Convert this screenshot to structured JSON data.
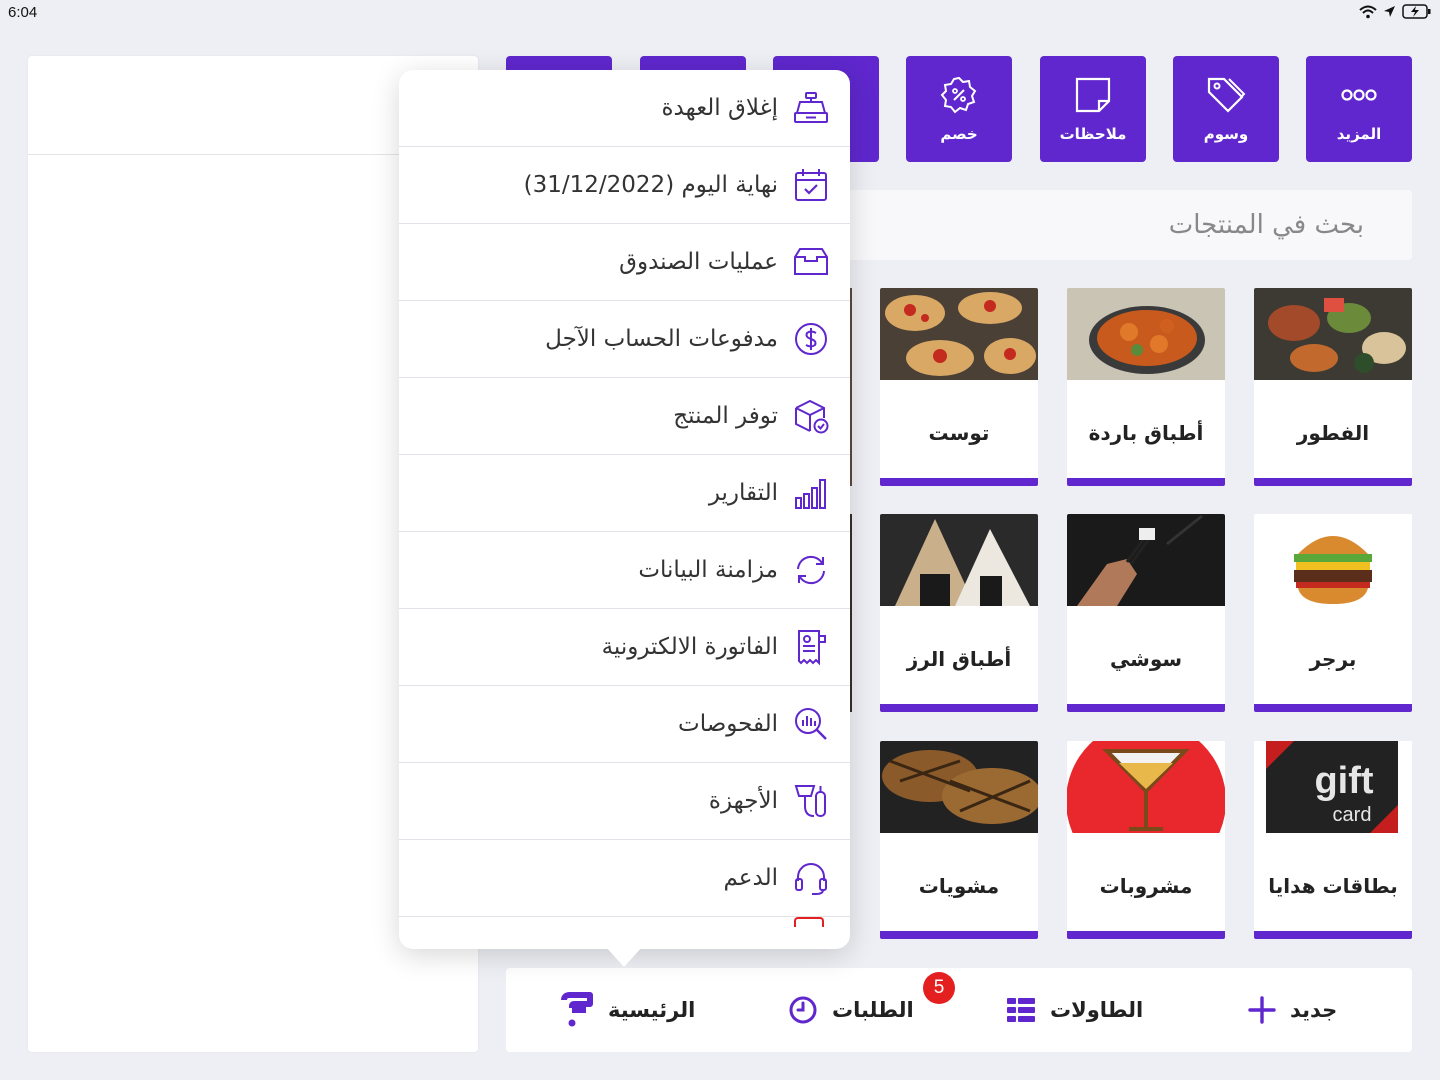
{
  "status": {
    "time": "6:04"
  },
  "top_buttons": [
    {
      "label": "المزيد",
      "icon": "more-dots-icon"
    },
    {
      "label": "وسوم",
      "icon": "tags-icon"
    },
    {
      "label": "ملاحظات",
      "icon": "notes-icon"
    },
    {
      "label": "خصم",
      "icon": "discount-icon"
    }
  ],
  "search": {
    "placeholder": "بحث في المنتجات"
  },
  "categories": [
    {
      "label": "الفطور",
      "image": "breakfast-image"
    },
    {
      "label": "أطباق باردة",
      "image": "cold-dishes-image"
    },
    {
      "label": "توست",
      "image": "toast-image"
    },
    {
      "label": "برجر",
      "image": "burger-image"
    },
    {
      "label": "سوشي",
      "image": "sushi-image"
    },
    {
      "label": "أطباق الرز",
      "image": "rice-dishes-image"
    },
    {
      "label": "بطاقات هدايا",
      "image": "gift-card-image",
      "image_text_1": "gift",
      "image_text_2": "card"
    },
    {
      "label": "مشروبات",
      "image": "drinks-image"
    },
    {
      "label": "مشويات",
      "image": "grills-image"
    }
  ],
  "menu": {
    "items": [
      {
        "label": "إغلاق العهدة",
        "icon": "cash-register-icon"
      },
      {
        "label": "نهاية اليوم (31/12/2022)",
        "icon": "calendar-check-icon"
      },
      {
        "label": "عمليات الصندوق",
        "icon": "cash-drawer-icon"
      },
      {
        "label": "مدفوعات الحساب الآجل",
        "icon": "dollar-circle-icon"
      },
      {
        "label": "توفر المنتج",
        "icon": "box-check-icon"
      },
      {
        "label": "التقارير",
        "icon": "bar-chart-icon"
      },
      {
        "label": "مزامنة البيانات",
        "icon": "sync-icon"
      },
      {
        "label": "الفاتورة الالكترونية",
        "icon": "e-invoice-icon"
      },
      {
        "label": "الفحوصات",
        "icon": "inspection-icon"
      },
      {
        "label": "الأجهزة",
        "icon": "devices-icon"
      },
      {
        "label": "الدعم",
        "icon": "headset-icon"
      }
    ]
  },
  "bottom_nav": {
    "new": "جديد",
    "tables": "الطاولات",
    "orders": "الطلبات",
    "orders_badge": "5",
    "home": "الرئيسية"
  },
  "colors": {
    "accent": "#5f27cd",
    "badge": "#e41f1f",
    "background": "#eeeff4"
  }
}
